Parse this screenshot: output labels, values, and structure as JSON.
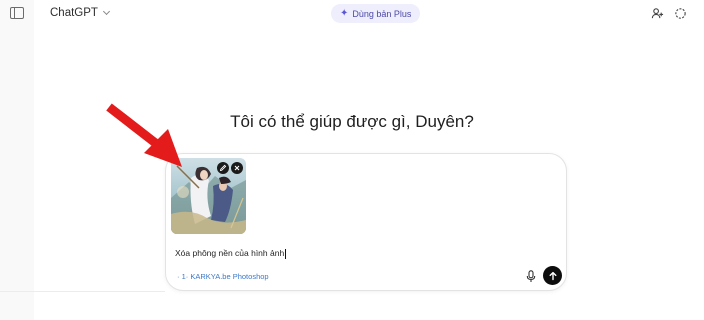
{
  "header": {
    "model_label": "ChatGPT",
    "upgrade_label": "Dùng bản Plus"
  },
  "main": {
    "greeting": "Tôi có thể giúp được gì, Duyên?"
  },
  "composer": {
    "prompt_text": "Xóa phông nền của hình ảnh",
    "watermark": "· 1· KARKYA.be Photoshop"
  },
  "icons": {
    "sidebar_toggle": "sidebar-toggle-icon",
    "add_user": "add-user-icon",
    "temporary_chat": "temporary-chat-icon",
    "edit": "pencil-icon",
    "remove": "close-icon",
    "mic": "microphone-icon",
    "send": "arrow-up-icon"
  },
  "colors": {
    "accent": "#5b56d6",
    "arrow": "#e31b1b",
    "send_button": "#0d0d0d"
  }
}
